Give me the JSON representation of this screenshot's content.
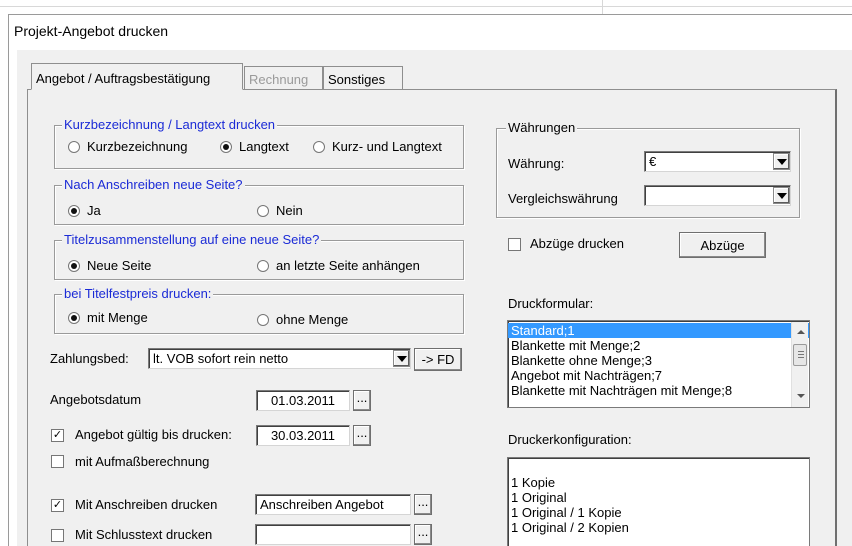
{
  "window": {
    "title": "Projekt-Angebot drucken"
  },
  "tabs": [
    {
      "label": "Angebot / Auftragsbestätigung",
      "active": true
    },
    {
      "label": "Rechnung",
      "disabled": true
    },
    {
      "label": "Sonstiges"
    }
  ],
  "kurz": {
    "legend": "Kurzbezeichnung / Langtext drucken",
    "options": [
      "Kurzbezeichnung",
      "Langtext",
      "Kurz- und Langtext"
    ],
    "selected": "Langtext"
  },
  "anschreiben": {
    "legend": "Nach Anschreiben neue Seite?",
    "options": [
      "Ja",
      "Nein"
    ],
    "selected": "Ja"
  },
  "titel": {
    "legend": "Titelzusammenstellung auf eine neue Seite?",
    "options": [
      "Neue Seite",
      "an letzte Seite anhängen"
    ],
    "selected": "Neue Seite"
  },
  "festpreis": {
    "legend": "bei Titelfestpreis drucken:",
    "options": [
      "mit Menge",
      "ohne Menge"
    ],
    "selected": "mit Menge"
  },
  "zahlung": {
    "label": "Zahlungsbed:",
    "value": "lt. VOB sofort rein netto",
    "fd_button": "-> FD"
  },
  "angebotsdatum": {
    "label": "Angebotsdatum",
    "value": "01.03.2011",
    "ellipsis": "..."
  },
  "gueltig": {
    "label": "Angebot gültig bis drucken:",
    "checked": true,
    "value": "30.03.2011",
    "ellipsis": "..."
  },
  "aufmass": {
    "label": "mit Aufmaßberechnung",
    "checked": false
  },
  "mit_anschreiben": {
    "label": "Mit Anschreiben drucken",
    "checked": true,
    "value": "Anschreiben Angebot",
    "ellipsis": "..."
  },
  "schlusstext": {
    "label": "Mit Schlusstext drucken",
    "checked": false,
    "value": "",
    "ellipsis": "..."
  },
  "waehrungen": {
    "legend": "Währungen",
    "waehrung_label": "Währung:",
    "waehrung_value": "€",
    "vergleich_label": "Vergleichswährung",
    "vergleich_value": ""
  },
  "abzuege": {
    "label": "Abzüge drucken",
    "checked": false,
    "button": "Abzüge"
  },
  "druckformular": {
    "label": "Druckformular:",
    "items": [
      "Standard;1",
      "Blankette mit Menge;2",
      "Blankette ohne Menge;3",
      "Angebot mit Nachträgen;7",
      "Blankette mit Nachträgen mit Menge;8"
    ],
    "selected_index": 0
  },
  "druckerkonfiguration": {
    "label": "Druckerkonfiguration:",
    "items": [
      "",
      "1 Kopie",
      "1 Original",
      "1 Original / 1 Kopie",
      "1 Original / 2 Kopien"
    ]
  },
  "colors": {
    "legend_blue": "#1b2bd6",
    "selection": "#3399ff",
    "panel": "#f0f0f0"
  }
}
